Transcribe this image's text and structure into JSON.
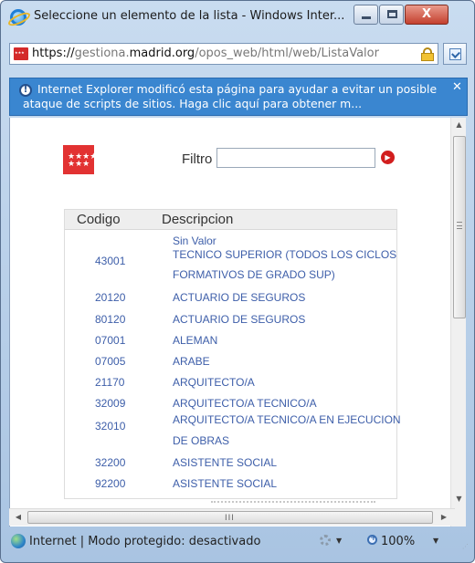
{
  "window": {
    "title": "Seleccione un elemento de la lista - Windows Inter...",
    "close_label": "X"
  },
  "address": {
    "proto": "https://",
    "pre_host": "gestiona.",
    "host": "madrid.org",
    "path": "/opos_web/html/web/ListaValor"
  },
  "infobar": {
    "message": "Internet Explorer modificó esta página para ayudar a evitar un posible ataque de scripts de sitios. Haga clic aquí para obtener m...",
    "close_glyph": "✕"
  },
  "page": {
    "logo_stars": "★★★★\n★★★",
    "filter": {
      "label": "Filtro",
      "value": "",
      "go_glyph": "▶"
    },
    "table": {
      "headers": [
        "Codigo",
        "Descripcion"
      ],
      "no_value_label": "Sin Valor",
      "rows": [
        {
          "code": "43001",
          "desc1": "TECNICO SUPERIOR (TODOS LOS CICLOS",
          "desc2": "FORMATIVOS DE GRADO SUP)"
        },
        {
          "code": "20120",
          "desc1": "ACTUARIO DE SEGUROS",
          "desc2": ""
        },
        {
          "code": "80120",
          "desc1": "ACTUARIO DE SEGUROS",
          "desc2": ""
        },
        {
          "code": "07001",
          "desc1": "ALEMAN",
          "desc2": ""
        },
        {
          "code": "07005",
          "desc1": "ARABE",
          "desc2": ""
        },
        {
          "code": "21170",
          "desc1": "ARQUITECTO/A",
          "desc2": ""
        },
        {
          "code": "32009",
          "desc1": "ARQUITECTO/A TECNICO/A",
          "desc2": ""
        },
        {
          "code": "32010",
          "desc1": "ARQUITECTO/A TECNICO/A EN EJECUCION",
          "desc2": "DE OBRAS"
        },
        {
          "code": "32200",
          "desc1": "ASISTENTE SOCIAL",
          "desc2": ""
        },
        {
          "code": "92200",
          "desc1": "ASISTENTE SOCIAL",
          "desc2": ""
        }
      ]
    }
  },
  "scrollbars": {
    "up": "▲",
    "down": "▼",
    "left": "◀",
    "right": "▶",
    "h_grip": "III"
  },
  "status": {
    "text": "Internet | Modo protegido: desactivado",
    "zoom": "100%",
    "dropdown_glyph": "▼"
  }
}
